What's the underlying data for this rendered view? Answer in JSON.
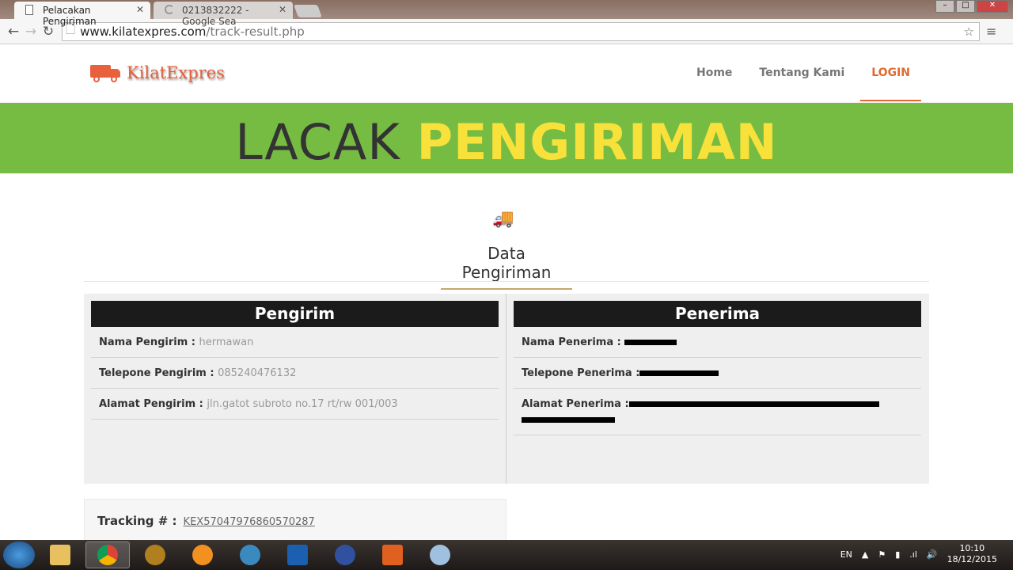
{
  "browser": {
    "tabs": [
      {
        "title": "Pelacakan Pengiriman",
        "active": true
      },
      {
        "title": "0213832222 - Google Sea",
        "active": false
      }
    ],
    "url_host": "www.kilatexpres.com",
    "url_path": "/track-result.php"
  },
  "site": {
    "logo": "KilatExpres",
    "nav": [
      {
        "label": "Home"
      },
      {
        "label": "Tentang Kami"
      },
      {
        "label": "LOGIN",
        "active": true
      }
    ],
    "banner_light": "LACAK",
    "banner_bold": "PENGIRIMAN",
    "section_title": "Data Pengiriman",
    "accent": "#e06a2e",
    "banner_color": "#76bc43",
    "banner_highlight": "#f7e13a"
  },
  "sender": {
    "heading": "Pengirim",
    "rows": [
      {
        "label": "Nama Pengirim :",
        "value": "hermawan"
      },
      {
        "label": "Telepone Pengirim :",
        "value": "085240476132"
      },
      {
        "label": "Alamat Pengirim :",
        "value": "jln.gatot subroto no.17 rt/rw 001/003"
      }
    ]
  },
  "receiver": {
    "heading": "Penerima",
    "rows": [
      {
        "label": "Nama Penerima :"
      },
      {
        "label": "Telepone Penerima :"
      },
      {
        "label": "Alamat Penerima :"
      }
    ]
  },
  "tracking": {
    "label": "Tracking # :",
    "number": "KEX57047976860570287"
  },
  "taskbar": {
    "lang": "EN",
    "time": "10:10",
    "date": "18/12/2015"
  }
}
